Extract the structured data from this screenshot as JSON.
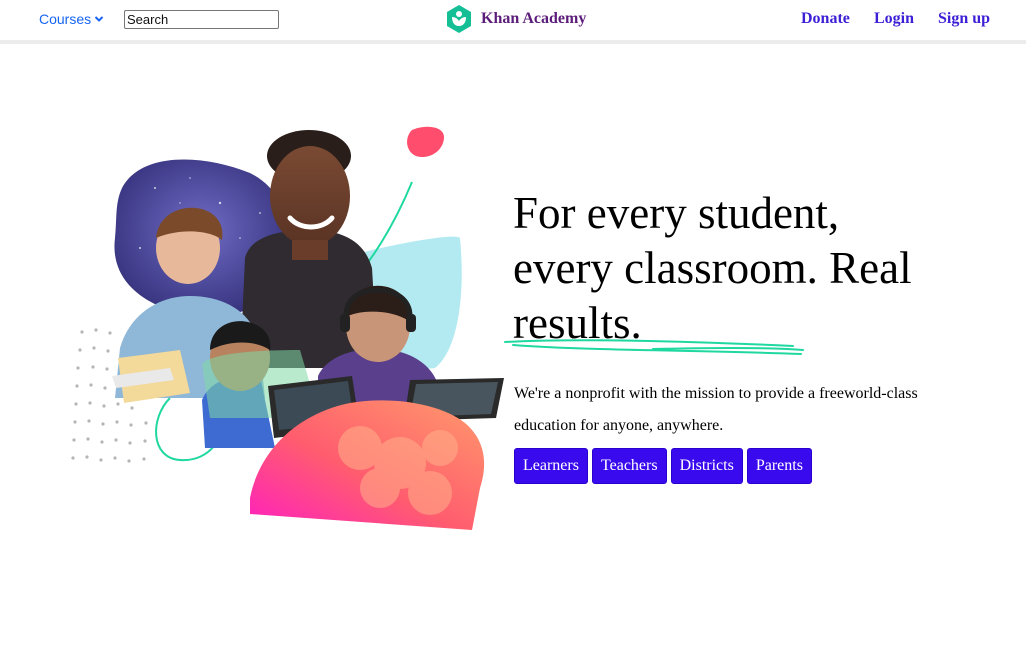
{
  "header": {
    "courses_label": "Courses",
    "search_placeholder": "Search",
    "brand_name": "Khan Academy",
    "donate_label": "Donate",
    "login_label": "Login",
    "signup_label": "Sign up"
  },
  "hero": {
    "headline_line1": "For every student,",
    "headline_line2": "every classroom. Real",
    "headline_line3": "results.",
    "subtext": "We're a nonprofit with the mission to provide a freeworld-class education for anyone, anywhere.",
    "buttons": [
      {
        "label": "Learners"
      },
      {
        "label": "Teachers"
      },
      {
        "label": "Districts"
      },
      {
        "label": "Parents"
      }
    ]
  },
  "colors": {
    "link_blue": "#1865f2",
    "brand_purple": "#5c1d7a",
    "nav_purple": "#3d1fd6",
    "cta_blue": "#3a0aef",
    "logo_green": "#14bf96",
    "accent_teal": "#1fd8a0"
  },
  "icons": {
    "courses_dropdown": "chevron-down-icon",
    "logo": "khan-academy-logo-icon"
  }
}
